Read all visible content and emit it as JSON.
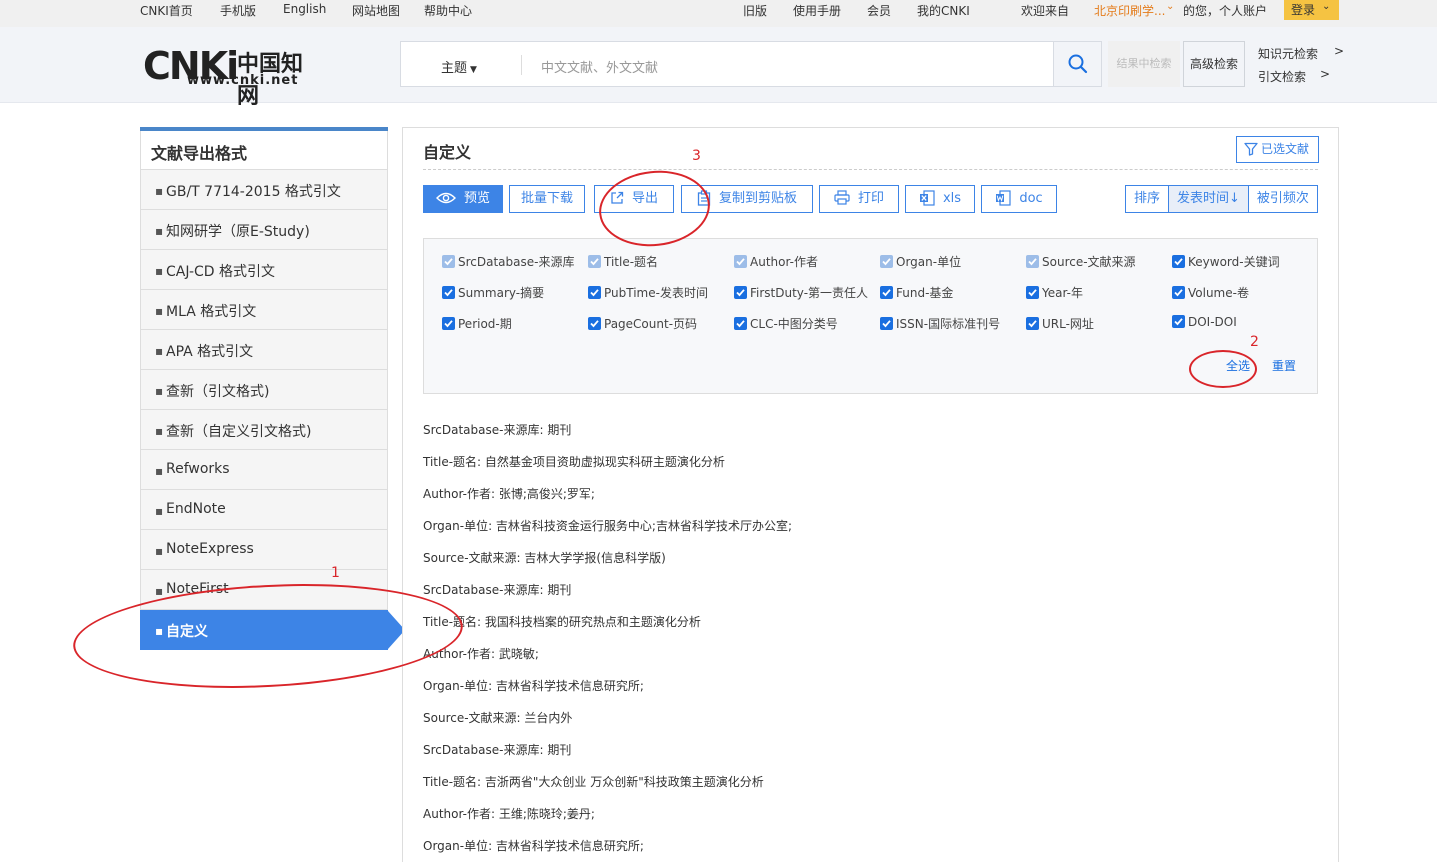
{
  "topbar": {
    "left_links": [
      "CNKI首页",
      "手机版",
      "English",
      "网站地图",
      "帮助中心"
    ],
    "right_links": [
      "旧版",
      "使用手册",
      "会员",
      "我的CNKI"
    ],
    "welcome": "欢迎来自",
    "org": "北京印刷学...",
    "greeting": "的您，个人账户",
    "login": "登录"
  },
  "header": {
    "logo_mark": "CNKi",
    "logo_cn": "中国知网",
    "logo_url": "www.cnki.net",
    "search_field": "主题",
    "search_placeholder": "中文文献、外文文献",
    "search_within": "结果中检索",
    "advanced": "高级检索",
    "knowledge": "知识元检索",
    "citation": "引文检索",
    "arrow": ">"
  },
  "sidebar": {
    "title": "文献导出格式",
    "items": [
      "GB/T 7714-2015 格式引文",
      "知网研学（原E-Study)",
      "CAJ-CD 格式引文",
      "MLA 格式引文",
      "APA 格式引文",
      "查新（引文格式)",
      "查新（自定义引文格式)",
      "Refworks",
      "EndNote",
      "NoteExpress",
      "NoteFirst",
      "自定义"
    ],
    "bullet": "▪"
  },
  "main": {
    "title": "自定义",
    "selected_docs": "已选文献",
    "toolbar": {
      "preview": "预览",
      "batch_download": "批量下载",
      "export": "导出",
      "copy": "复制到剪贴板",
      "print": "打印",
      "xls": "xls",
      "doc": "doc"
    },
    "sort": {
      "label": "排序",
      "pub_time": "发表时间↓",
      "cited": "被引频次"
    },
    "fields": [
      [
        "SrcDatabase-来源库",
        "Title-题名",
        "Author-作者",
        "Organ-单位",
        "Source-文献来源",
        "Keyword-关键词"
      ],
      [
        "Summary-摘要",
        "PubTime-发表时间",
        "FirstDuty-第一责任人",
        "Fund-基金",
        "Year-年",
        "Volume-卷"
      ],
      [
        "Period-期",
        "PageCount-页码",
        "CLC-中图分类号",
        "ISSN-国际标准刊号",
        "URL-网址",
        "DOI-DOI"
      ]
    ],
    "select_all": "全选",
    "reset": "重置",
    "output_lines": [
      "SrcDatabase-来源库: 期刊",
      "Title-题名: 自然基金项目资助虚拟现实科研主题演化分析",
      "Author-作者: 张博;高俊兴;罗军;",
      "Organ-单位: 吉林省科技资金运行服务中心;吉林省科学技术厅办公室;",
      "Source-文献来源: 吉林大学学报(信息科学版)",
      "SrcDatabase-来源库: 期刊",
      "Title-题名: 我国科技档案的研究热点和主题演化分析",
      "Author-作者: 武晓敏;",
      "Organ-单位: 吉林省科学技术信息研究所;",
      "Source-文献来源: 兰台内外",
      "SrcDatabase-来源库: 期刊",
      "Title-题名: 吉浙两省\"大众创业 万众创新\"科技政策主题演化分析",
      "Author-作者: 王维;陈晓玲;姜丹;",
      "Organ-单位: 吉林省科学技术信息研究所;"
    ]
  },
  "annotations": [
    "1",
    "2",
    "3"
  ],
  "colors": {
    "accent": "#3d84e6",
    "annotation": "#d9252a",
    "login": "#f5c342",
    "org": "#e47c1b"
  },
  "icons": [
    "search-icon",
    "eye-icon",
    "export-icon",
    "clipboard-icon",
    "printer-icon",
    "excel-icon",
    "word-icon",
    "filter-icon",
    "checkbox-checked-icon",
    "chevron-down-icon"
  ]
}
